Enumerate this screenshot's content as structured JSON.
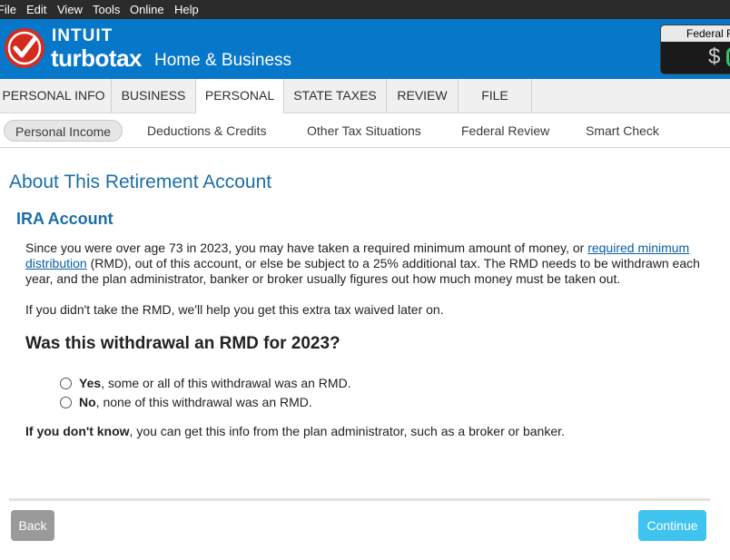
{
  "menubar": {
    "items": [
      "File",
      "Edit",
      "View",
      "Tools",
      "Online",
      "Help"
    ]
  },
  "header": {
    "brand_intuit": "INTUIT",
    "brand_turbotax": "turbotax",
    "edition": "Home & Business",
    "refund_label": "Federal R",
    "refund_symbol": "$"
  },
  "main_tabs": [
    "PERSONAL INFO",
    "BUSINESS",
    "PERSONAL",
    "STATE TAXES",
    "REVIEW",
    "FILE"
  ],
  "sub_tabs": [
    "Personal Income",
    "Deductions & Credits",
    "Other Tax Situations",
    "Federal Review",
    "Smart Check"
  ],
  "content": {
    "page_title": "About This Retirement Account",
    "section_title": "IRA Account",
    "intro_before_link": "Since you were over age 73 in 2023, you may have taken a required minimum amount of money, or ",
    "intro_link": "required minimum distribution",
    "intro_after_link": " (RMD), out of this account, or else be subject to a 25% additional tax. The RMD needs to be withdrawn each year, and the plan administrator, banker or broker usually figures out how much money must be taken out.",
    "waive_text": "If you didn't take the RMD, we'll help you get this extra tax waived later on.",
    "question": "Was this withdrawal an RMD for 2023?",
    "options": [
      {
        "bold": "Yes",
        "rest": ", some or all of this withdrawal was an RMD."
      },
      {
        "bold": "No",
        "rest": ", none of this withdrawal was an RMD."
      }
    ],
    "dontknow_bold": "If you don't know",
    "dontknow_rest": ", you can get this info from the plan administrator, such as a broker or banker."
  },
  "footer": {
    "back_label": "Back",
    "continue_label": "Continue"
  },
  "colors": {
    "header_blue": "#0677c9",
    "title_blue": "#1a6fa8",
    "continue_cyan": "#3ec4ef",
    "back_gray": "#9a9a9a",
    "logo_red": "#d52b1e"
  }
}
